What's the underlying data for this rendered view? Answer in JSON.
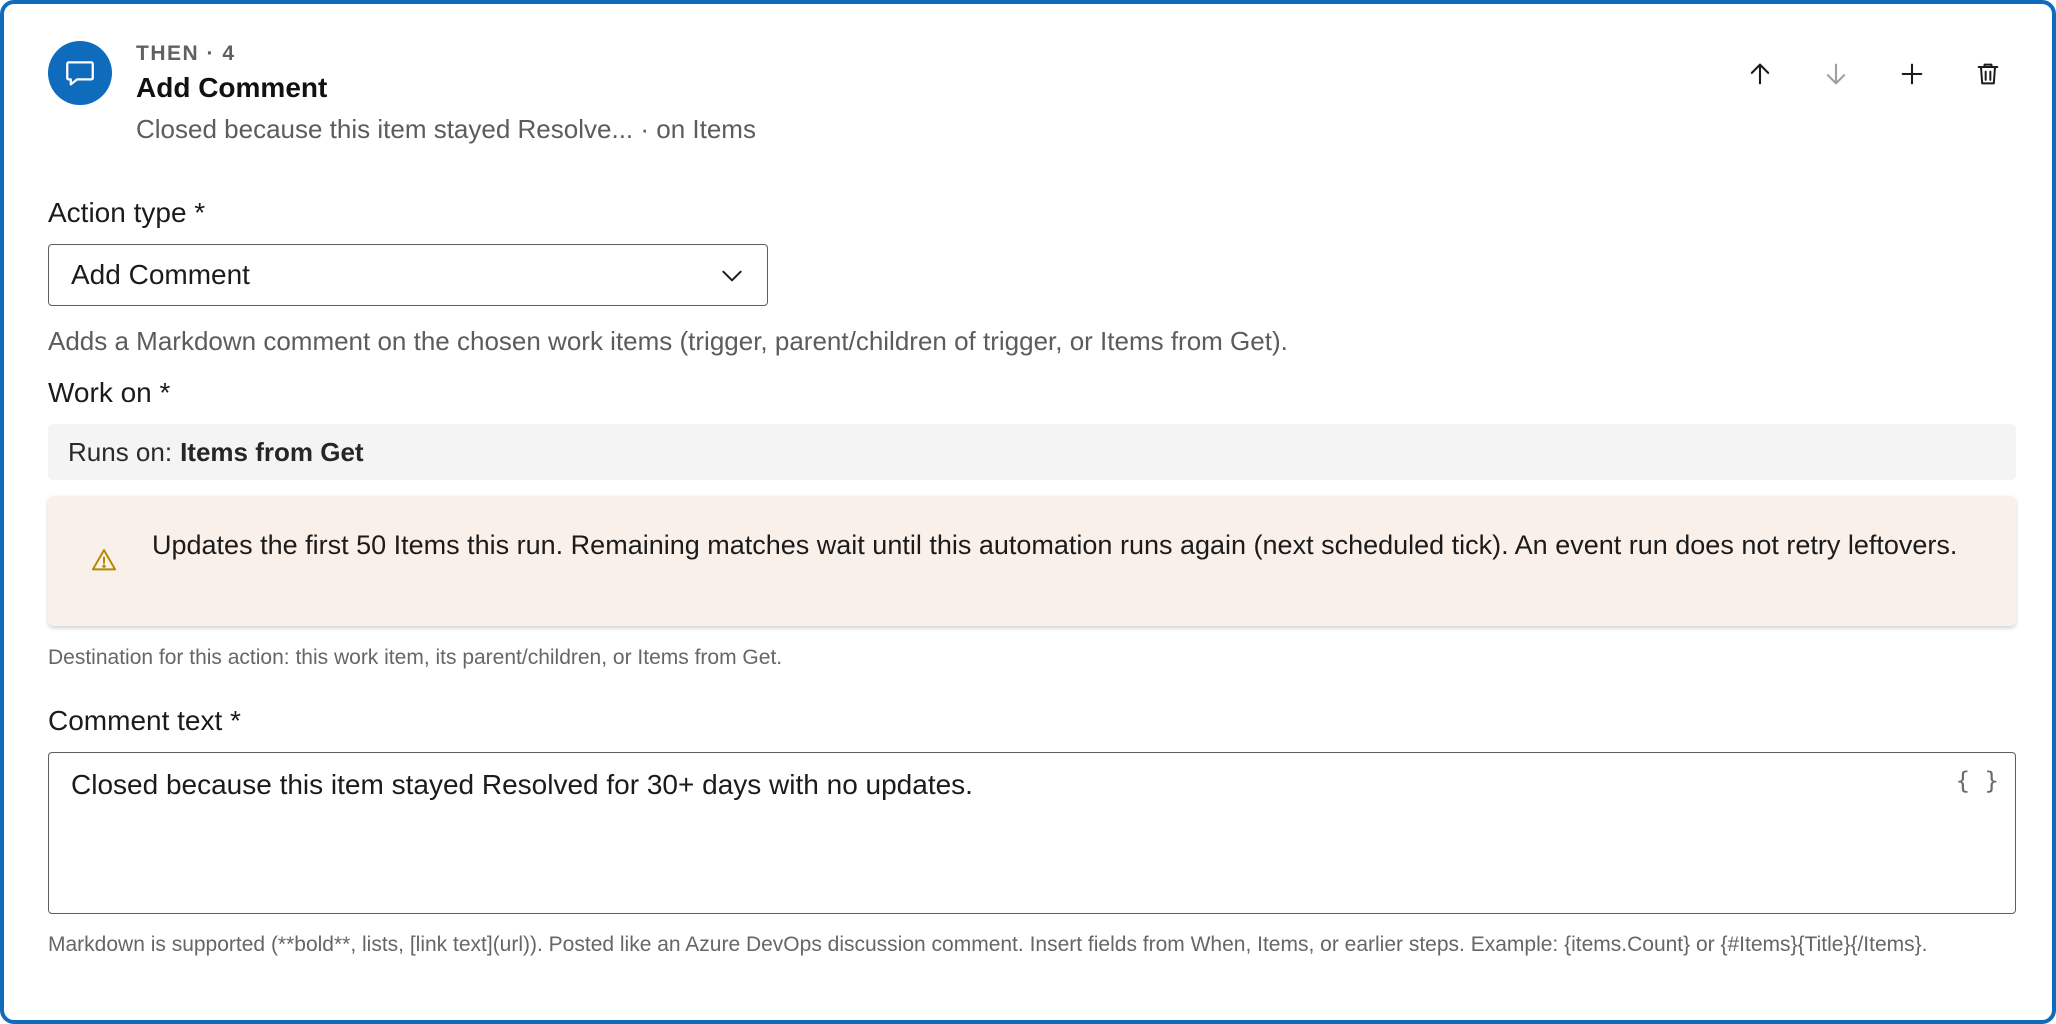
{
  "header": {
    "step_label": "THEN · 4",
    "title": "Add Comment",
    "summary": "Closed because this item stayed Resolve... · on Items",
    "tools": [
      "arrow-up-icon",
      "arrow-down-icon",
      "plus-icon",
      "trash-icon"
    ]
  },
  "action_type": {
    "label": "Action type *",
    "selected": "Add Comment",
    "help": "Adds a Markdown comment on the chosen work items (trigger, parent/children of trigger, or Items from Get)."
  },
  "work_on": {
    "label": "Work on *",
    "runs_on_prefix": "Runs on:",
    "runs_on_value": "Items from Get",
    "warning": "Updates the first 50 Items this run. Remaining matches wait until this automation runs again (next scheduled tick). An event run does not retry leftovers.",
    "help": "Destination for this action: this work item, its parent/children, or Items from Get."
  },
  "comment": {
    "label": "Comment text *",
    "value": "Closed because this item stayed Resolved for 30+ days with no updates.",
    "braces": "{ }",
    "help": "Markdown is supported (**bold**, lists, [link text](url)). Posted like an Azure DevOps discussion comment. Insert fields from When, Items, or earlier steps. Example: {items.Count} or {#Items}{Title}{/Items}."
  },
  "colors": {
    "accent": "#0f6cbd",
    "warning_bg": "#f9f0ea",
    "warning_icon": "#b58a00"
  }
}
